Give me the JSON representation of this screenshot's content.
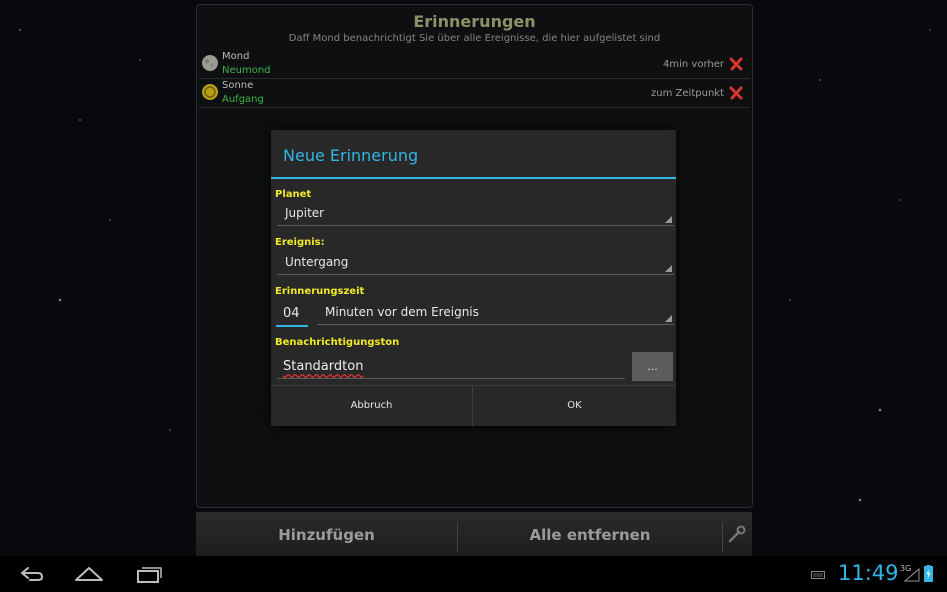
{
  "app": {
    "title": "Erinnerungen",
    "subtitle": "Daff Mond benachrichtigt Sie über alle Ereignisse, die hier aufgelistet sind"
  },
  "reminders": [
    {
      "body": "Mond",
      "event": "Neumond",
      "time": "4min vorher",
      "icon": "moon-icon"
    },
    {
      "body": "Sonne",
      "event": "Aufgang",
      "time": "zum Zeitpunkt",
      "icon": "sun-icon"
    }
  ],
  "dialog": {
    "title": "Neue Erinnerung",
    "planet_label": "Planet",
    "planet_value": "Jupiter",
    "event_label": "Ereignis:",
    "event_value": "Untergang",
    "time_label": "Erinnerungszeit",
    "minutes_value": "04",
    "time_unit_value": "Minuten vor dem Ereignis",
    "sound_label": "Benachrichtigungston",
    "sound_value": "Standardton",
    "browse_label": "...",
    "cancel_label": "Abbruch",
    "ok_label": "OK"
  },
  "actions": {
    "add_label": "Hinzufügen",
    "remove_all_label": "Alle entfernen"
  },
  "system": {
    "clock": "11:49",
    "network": "3G"
  },
  "colors": {
    "accent": "#33b5e5",
    "label_yellow": "#f0ea2a",
    "event_green": "#39b74a",
    "delete_red": "#d9352f",
    "title_olive": "#8d9168"
  }
}
